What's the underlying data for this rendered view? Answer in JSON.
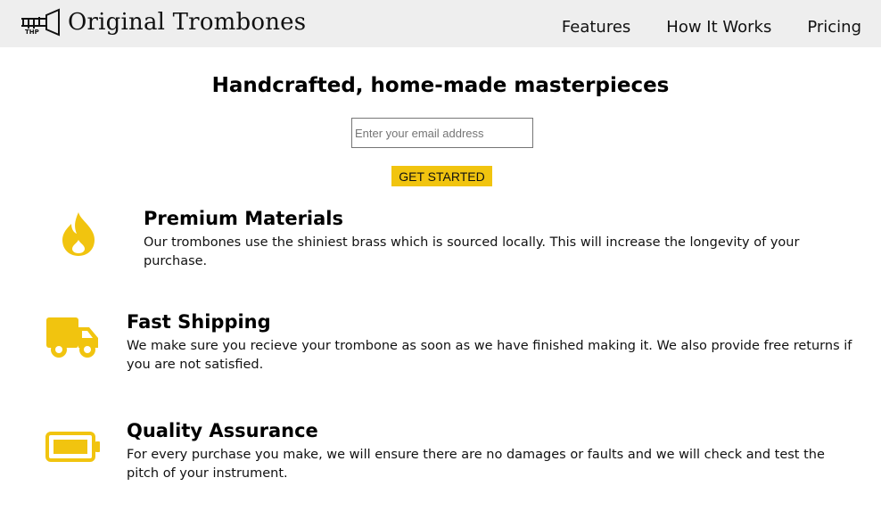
{
  "header": {
    "brand": "Original Trombones",
    "logo_icon": "trombone-logo-icon",
    "nav": [
      {
        "label": "Features"
      },
      {
        "label": "How It Works"
      },
      {
        "label": "Pricing"
      }
    ]
  },
  "hero": {
    "title": "Handcrafted, home-made masterpieces",
    "email_placeholder": "Enter your email address",
    "button_label": "GET STARTED"
  },
  "features": [
    {
      "icon": "fire-icon",
      "title": "Premium Materials",
      "description": "Our trombones use the shiniest brass which is sourced locally. This will increase the longevity of your purchase."
    },
    {
      "icon": "truck-icon",
      "title": "Fast Shipping",
      "description": "We make sure you recieve your trombone as soon as we have finished making it. We also provide free returns if you are not satisfied."
    },
    {
      "icon": "battery-icon",
      "title": "Quality Assurance",
      "description": "For every purchase you make, we will ensure there are no damages or faults and we will check and test the pitch of your instrument."
    }
  ],
  "colors": {
    "accent": "#f1c40f",
    "header_bg": "#eeeeee"
  }
}
